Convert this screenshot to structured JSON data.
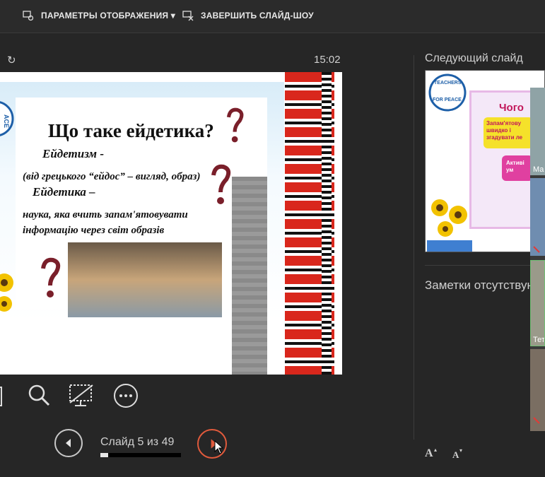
{
  "topbar": {
    "display_settings_label": "ПАРАМЕТРЫ ОТОБРАЖЕНИЯ ▾",
    "end_show_label": "ЗАВЕРШИТЬ СЛАЙД-ШОУ"
  },
  "presenter": {
    "timer": "15:02",
    "refresh_icon": "↻"
  },
  "slide": {
    "title": "Що таке ейдетика?",
    "line1": "Ейдетизм -",
    "line2": "(від грецького “ейдос” – вигляд, образ)",
    "line3": "Ейдетика –",
    "line4": "наука, яка вчить запам'ятовувати",
    "line5": "інформацію через світ образів",
    "logo_text": "ACE"
  },
  "navigation": {
    "counter": "Слайд 5 из 49",
    "current": 5,
    "total": 49,
    "progress_fraction": 0.1
  },
  "side": {
    "next_slide_label": "Следующий слайд",
    "notes_label": "Заметки отсутствуют",
    "increase_font_label": "A",
    "decrease_font_label": "A",
    "next_thumb": {
      "logo_top": "TEACHERS",
      "logo_bottom": "FOR PEACE",
      "heading": "Чого",
      "yellow_text": "Запам'ятову швидко і згадувати ле",
      "pink_text": "Активі ум"
    }
  },
  "participants": [
    {
      "name": "Ма"
    },
    {
      "name": "Тет"
    }
  ],
  "colors": {
    "background": "#262626",
    "accent_next": "#e05a3c"
  }
}
